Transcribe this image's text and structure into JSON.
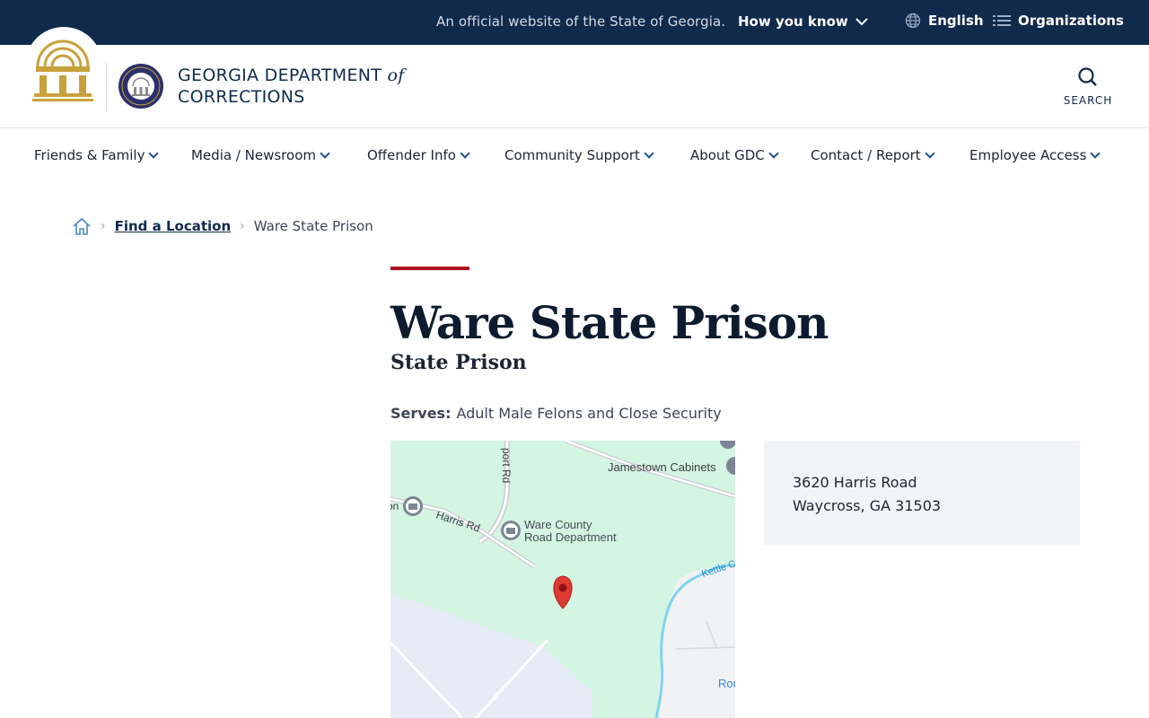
{
  "topbar": {
    "official_text": "An official website of the State of Georgia.",
    "how_you_know": "How you know",
    "language": "English",
    "organizations": "Organizations"
  },
  "header": {
    "agency_line1": "GEORGIA DEPARTMENT",
    "agency_of": "of",
    "agency_line2": "CORRECTIONS",
    "search_label": "SEARCH"
  },
  "nav": {
    "items": [
      {
        "label": "Friends & Family"
      },
      {
        "label": "Media / Newsroom"
      },
      {
        "label": "Offender Info"
      },
      {
        "label": "Community Support"
      },
      {
        "label": "About GDC"
      },
      {
        "label": "Contact / Report"
      },
      {
        "label": "Employee Access"
      }
    ]
  },
  "breadcrumb": {
    "link": "Find a Location",
    "current": "Ware State Prison"
  },
  "page": {
    "title": "Ware State Prison",
    "subtitle": "State Prison",
    "serves_label": "Serves:",
    "serves_value": "Adult Male Felons and Close Security"
  },
  "map": {
    "labels": {
      "road_vertical": "port Rd",
      "jamestown": "Jamestown Cabinets",
      "harris_rd": "Harris Rd",
      "ware_county_1": "Ware County",
      "ware_county_2": "Road Department",
      "kettle": "Kettle C",
      "on": "on",
      "rou": "Rou"
    }
  },
  "address": {
    "line1": "3620 Harris Road",
    "line2": "Waycross, GA 31503"
  },
  "colors": {
    "topbar_bg": "#102a4c",
    "accent_red": "#b1121f",
    "link_blue": "#102a4c",
    "gold": "#c9a13b",
    "map_green": "#d4f5e2"
  }
}
